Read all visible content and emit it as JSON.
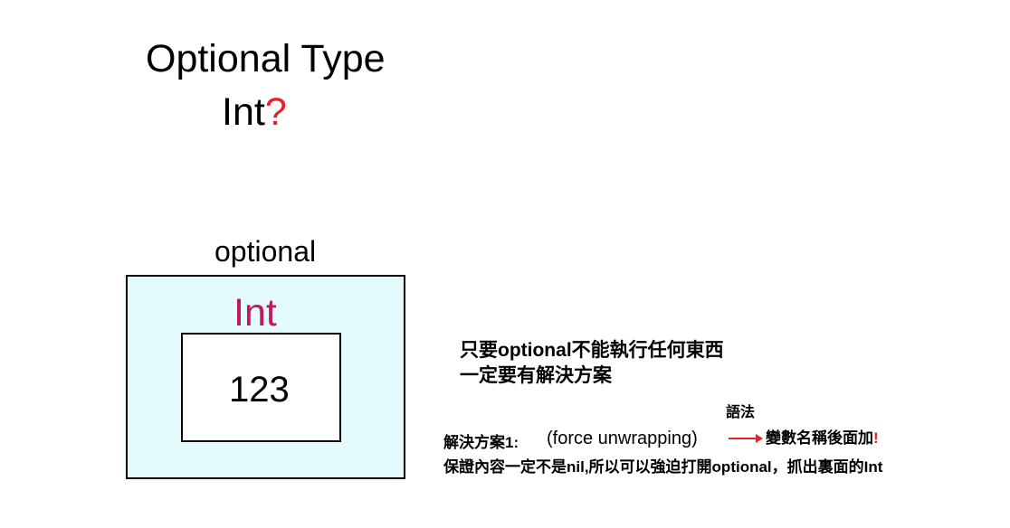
{
  "slide": {
    "title": "Optional Type",
    "subtitle_type": "Int",
    "subtitle_mark": "?",
    "box_label": "optional",
    "inner_type_label": "Int",
    "inner_value": "123",
    "note_line1": "只要optional不能執行任何東西",
    "note_line2": "一定要有解決方案",
    "syntax_label": "語法",
    "solution_label": "解決方案1:",
    "solution_name": "(force unwrapping)",
    "syntax_rule": "變數名稱後面加",
    "syntax_rule_mark": "!",
    "solution_description": "保證內容一定不是nil,所以可以強迫打開optional，抓出裏面的Int"
  },
  "colors": {
    "accent_red": "#e8202a",
    "int_label": "#c2185b",
    "outer_box_fill": "#e3fbfb"
  },
  "icons": {
    "arrow": "right-arrow-icon"
  }
}
